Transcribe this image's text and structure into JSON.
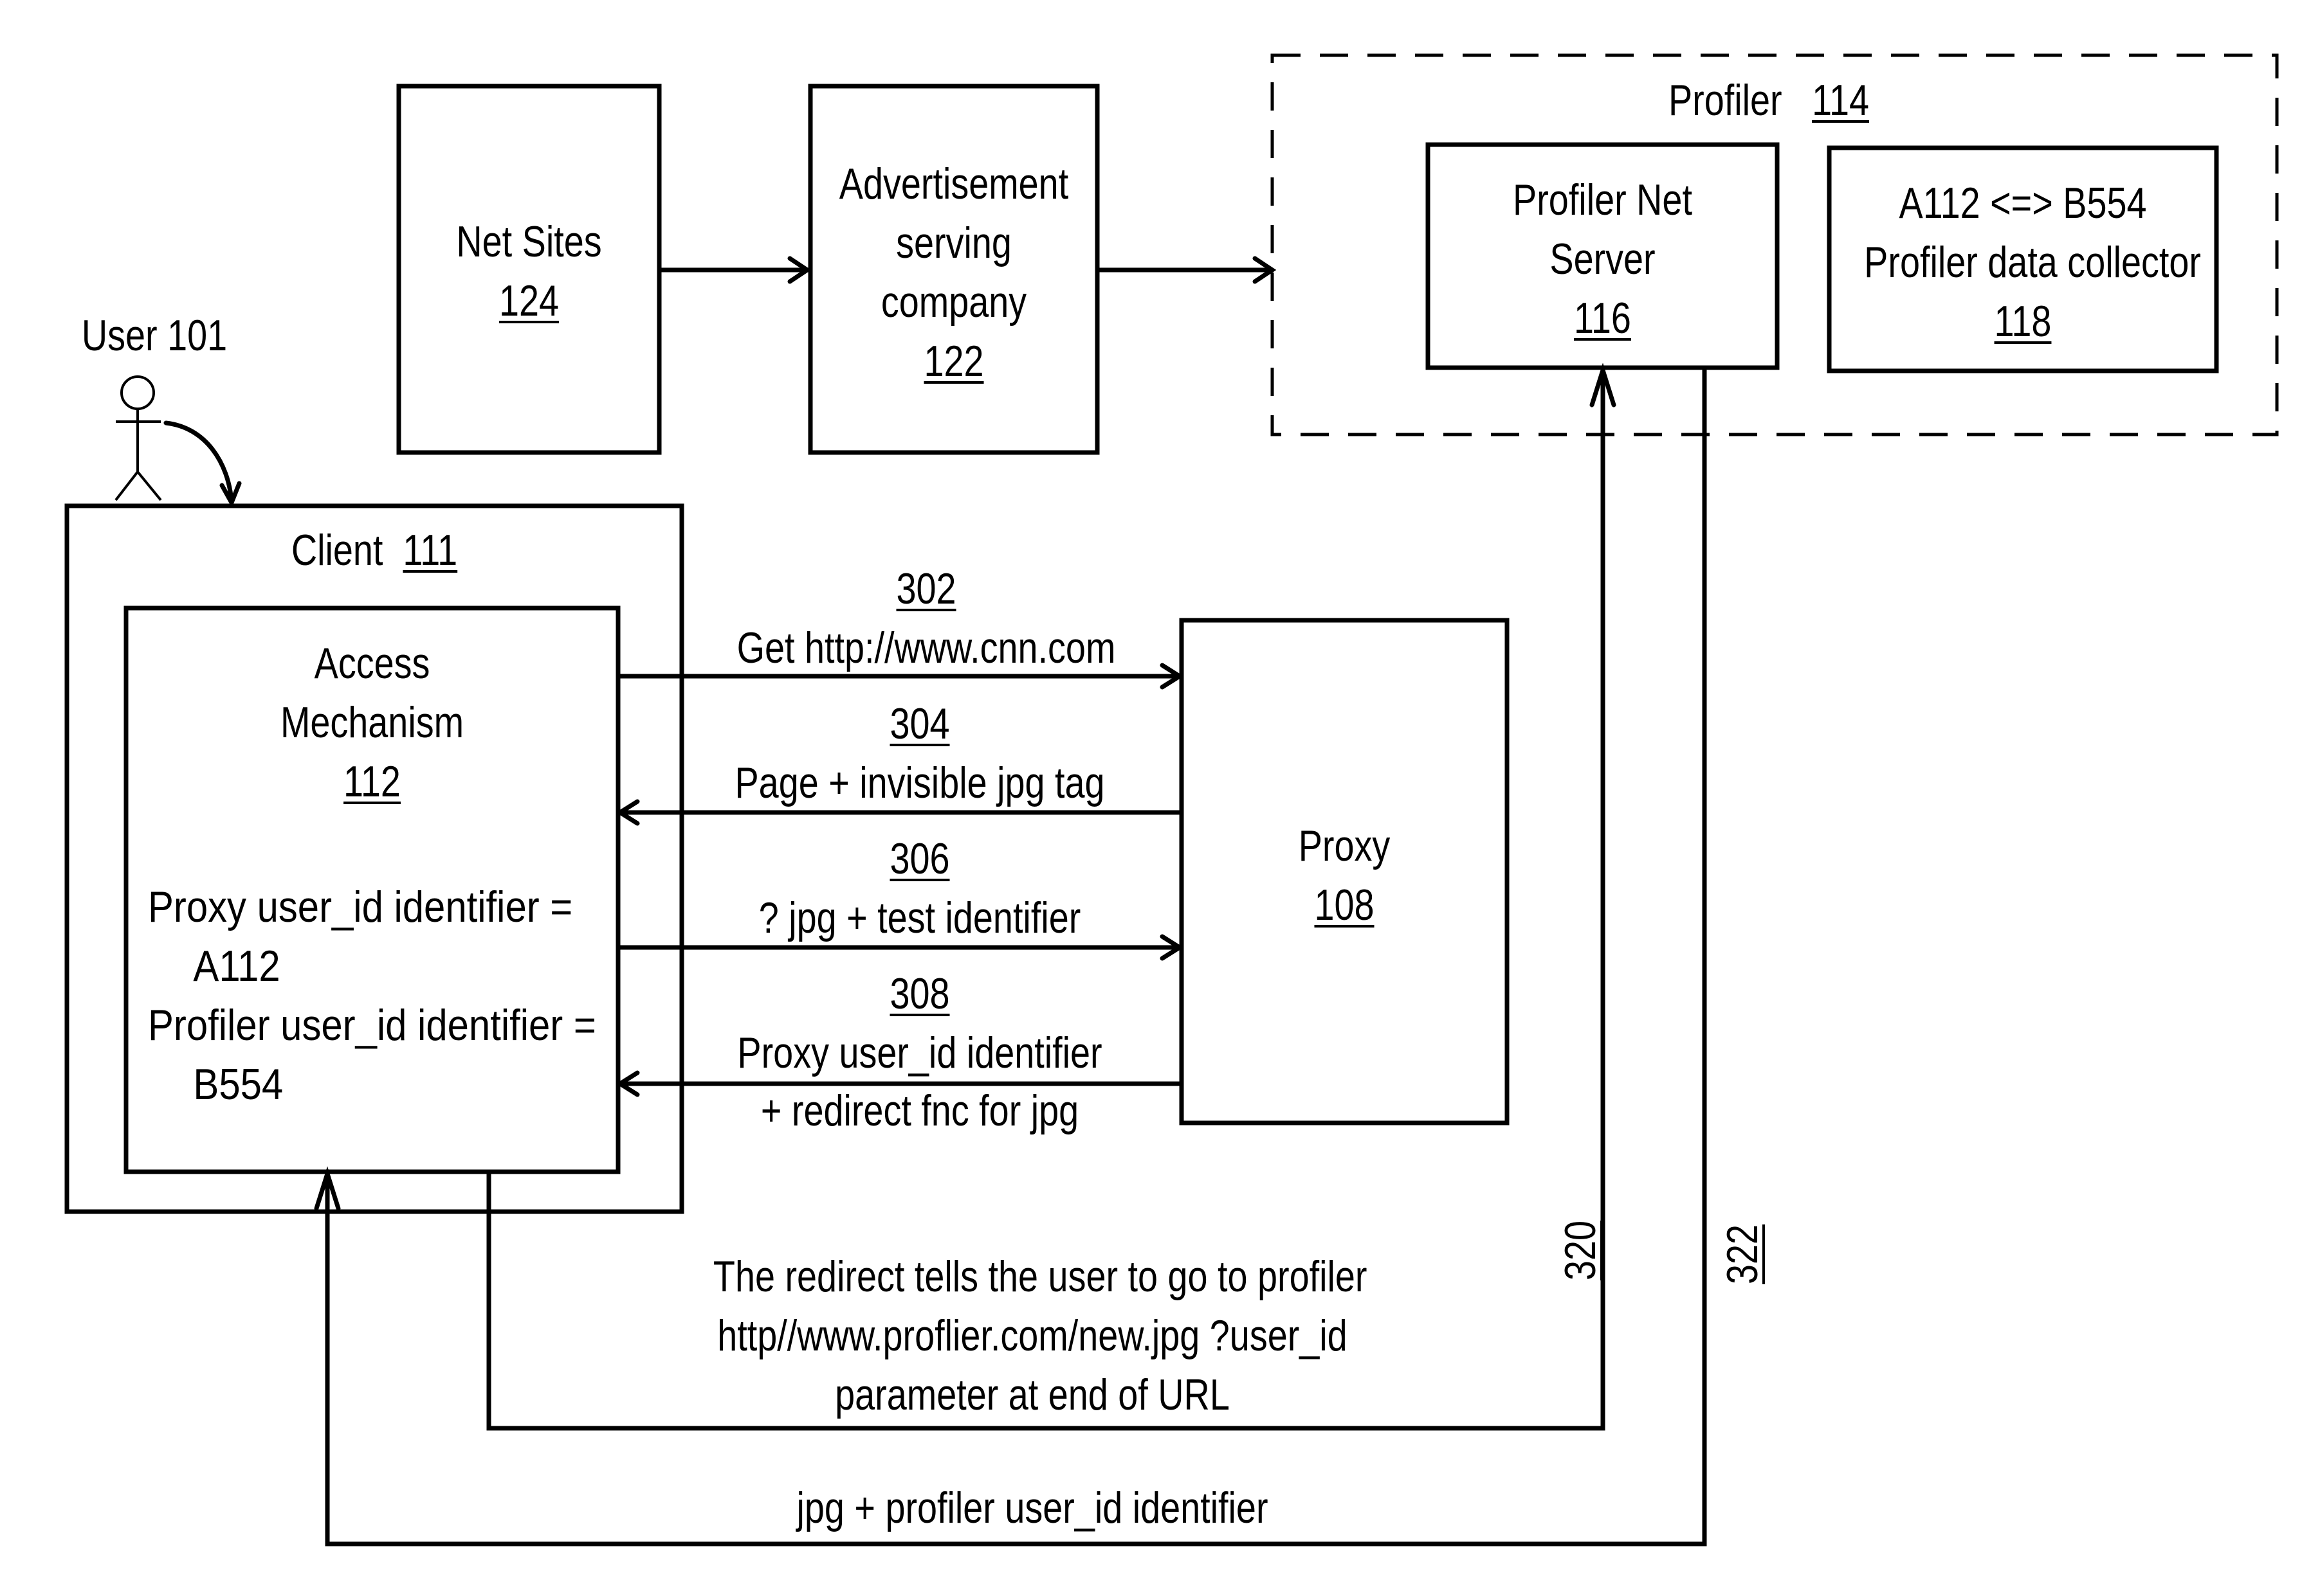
{
  "figure": {
    "user": {
      "label": "User 101"
    },
    "net_sites": {
      "name": "Net Sites",
      "ref": "124"
    },
    "ad_company": {
      "lines": [
        "Advertisement",
        "serving",
        "company"
      ],
      "ref": "122"
    },
    "profiler": {
      "name": "Profiler",
      "ref": "114",
      "net_server": {
        "lines": [
          "Profiler Net",
          "Server"
        ],
        "ref": "116"
      },
      "data_collector": {
        "lines": [
          "A112 <=> B554",
          "Profiler data collector"
        ],
        "ref": "118"
      }
    },
    "client": {
      "name": "Client",
      "ref": "111",
      "access_mechanism": {
        "lines": [
          "Access",
          "Mechanism"
        ],
        "ref": "112",
        "proxy_id_label": "Proxy user_id identifier =",
        "proxy_id_value": "A112",
        "profiler_id_label": "Profiler user_id identifier =",
        "profiler_id_value": "B554"
      }
    },
    "proxy": {
      "name": "Proxy",
      "ref": "108"
    },
    "messages": [
      {
        "ref": "302",
        "lines": [
          "Get http://www.cnn.com"
        ],
        "direction": "client-to-proxy"
      },
      {
        "ref": "304",
        "lines": [
          "Page + invisible jpg tag"
        ],
        "direction": "proxy-to-client"
      },
      {
        "ref": "306",
        "lines": [
          "? jpg + test  identifier"
        ],
        "direction": "client-to-proxy"
      },
      {
        "ref": "308",
        "lines": [
          "Proxy user_id identifier",
          "+ redirect fnc for jpg"
        ],
        "direction": "proxy-to-client"
      }
    ],
    "redirect_note": {
      "lines": [
        "The redirect tells the user to go to profiler",
        "http//www.proflier.com/new.jpg ?user_id",
        "parameter at end of URL"
      ],
      "ref": "320"
    },
    "return_path": {
      "label": "jpg  +  profiler user_id identifier",
      "ref": "322"
    }
  }
}
